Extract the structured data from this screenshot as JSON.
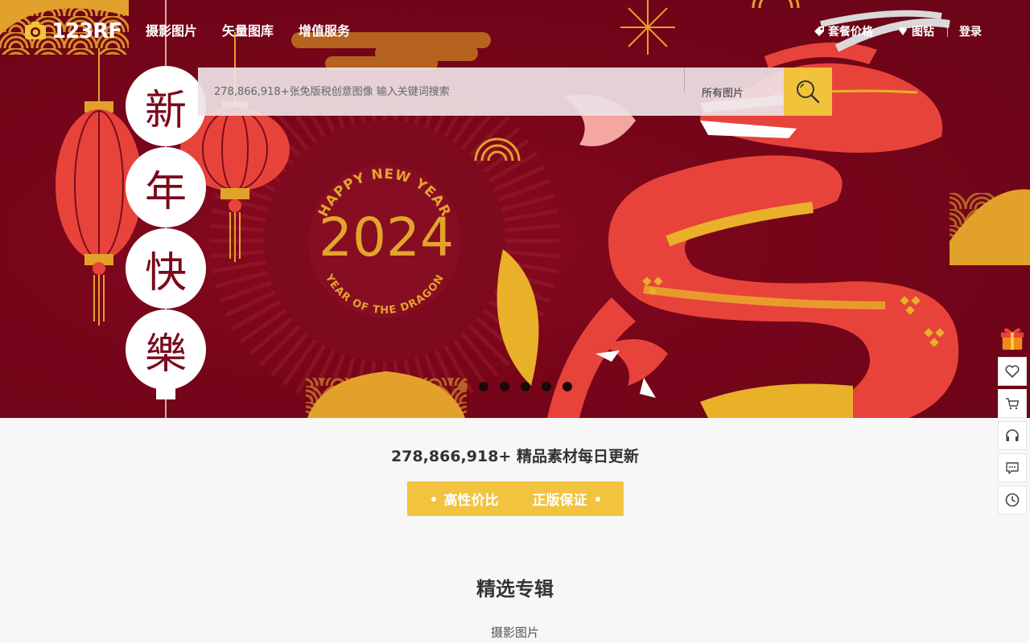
{
  "brand": {
    "name": "123RF"
  },
  "nav": {
    "links": [
      "摄影图片",
      "矢量图库",
      "增值服务"
    ],
    "pricing": "套餐价格",
    "diamond": "图钻",
    "login": "登录"
  },
  "hero": {
    "vertical_chars": [
      "新",
      "年",
      "快",
      "樂"
    ],
    "badge_arc_top": "HAPPY NEW YEAR",
    "badge_year": "2024",
    "badge_arc_bottom": "YEAR OF THE DRAGON",
    "carousel": {
      "total": 6,
      "active": 0
    }
  },
  "search": {
    "placeholder": "278,866,918+张免版税创意图像 输入关键词搜索",
    "scope": "所有图片"
  },
  "stats": {
    "text": "278,866,918+ 精品素材每日更新"
  },
  "badge": {
    "left": "高性价比",
    "right": "正版保证"
  },
  "featured": {
    "title": "精选专辑",
    "subtitle": "摄影图片"
  },
  "sidebar": {
    "icons": [
      "gift-icon",
      "heart-icon",
      "cart-icon",
      "headset-icon",
      "chat-icon",
      "clock-icon"
    ]
  },
  "colors": {
    "hero_bg": "#76051a",
    "accent": "#f1c33a",
    "dragon_red": "#e8433a",
    "gold": "#e9a52a"
  }
}
